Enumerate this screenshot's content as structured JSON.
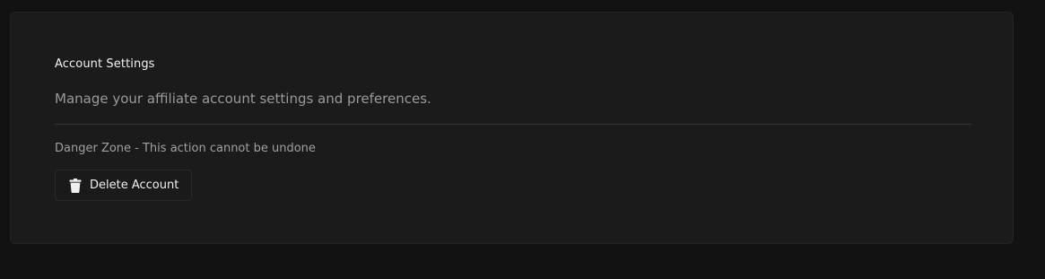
{
  "section": {
    "title": "Account Settings",
    "description": "Manage your affiliate account settings and preferences.",
    "danger_zone": "Danger Zone - This action cannot be undone",
    "delete_button": {
      "label": "Delete Account",
      "icon": "trash-icon"
    }
  },
  "colors": {
    "page_background": "#121212",
    "card_background": "#1b1b1b",
    "text_primary": "#f2f2f2",
    "text_muted": "#9a9a9a"
  }
}
